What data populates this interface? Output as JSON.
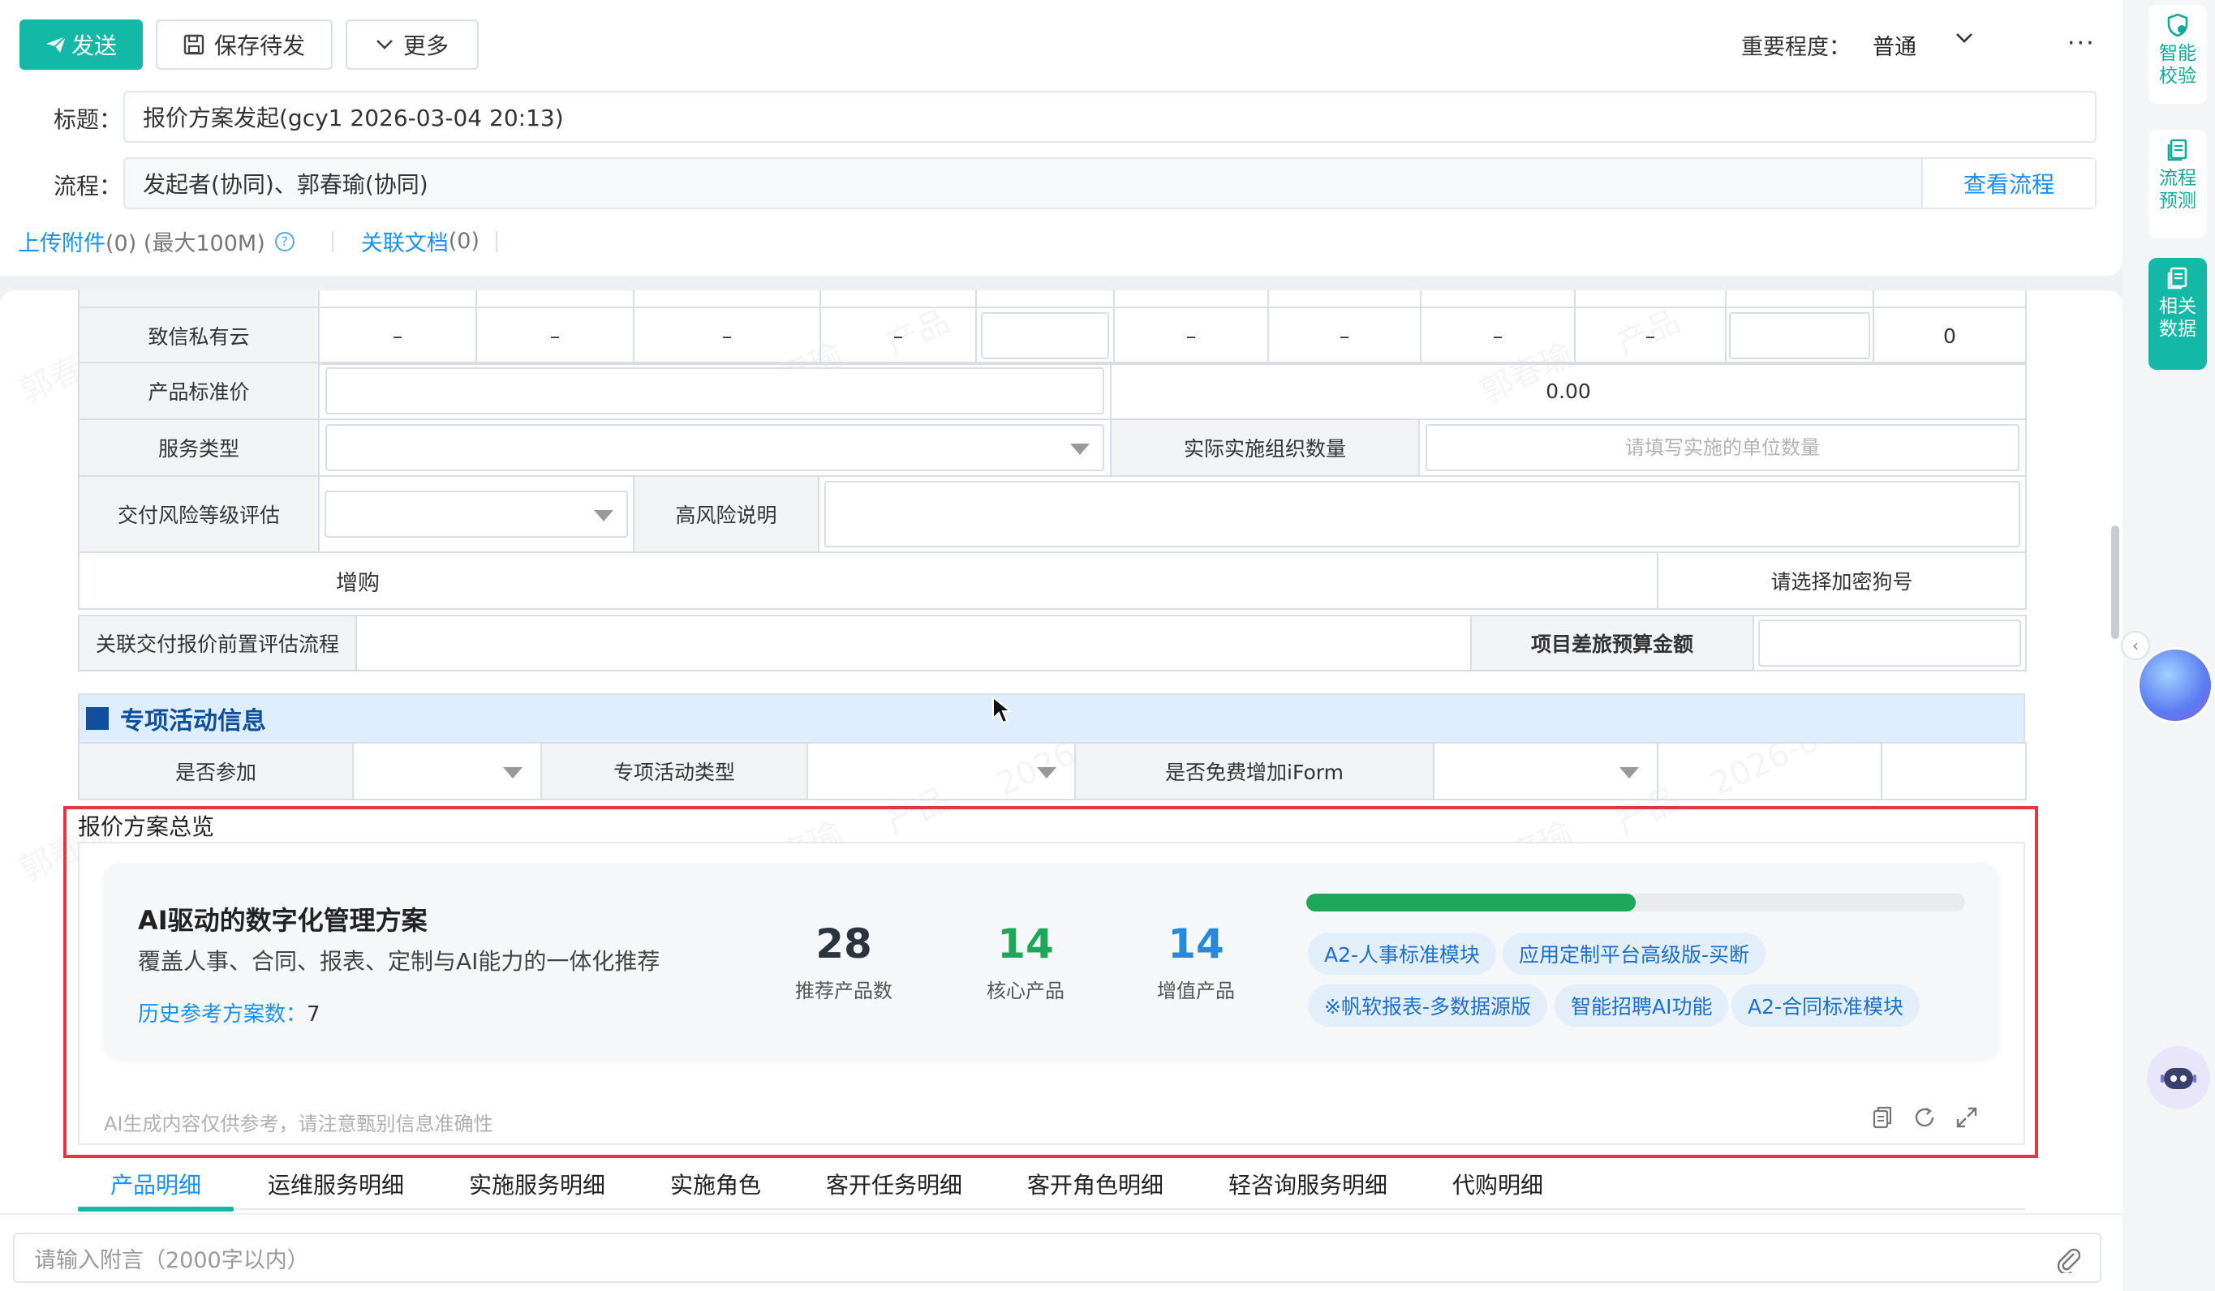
{
  "toolbar": {
    "send_label": "发送",
    "save_draft_label": "保存待发",
    "more_label": "更多",
    "importance_label": "重要程度：",
    "importance_value": "普通",
    "ellipsis": "···"
  },
  "form": {
    "title_label": "标题：",
    "title_value": "报价方案发起(gcy1 2026-03-04 20:13)",
    "flow_label": "流程：",
    "flow_value": "发起者(协同)、郭春瑜(协同)",
    "view_flow_label": "查看流程"
  },
  "attachments": {
    "upload_link": "上传附件",
    "upload_count": "(0) (最大100M)",
    "help_icon": "?",
    "related_docs_link": "关联文档",
    "related_docs_count": "(0)"
  },
  "table": {
    "row_private_cloud": {
      "label": "致信私有云",
      "dash": "–",
      "value_last": "0"
    },
    "product_price": {
      "label": "产品标准价",
      "value": "0.00"
    },
    "service_type": {
      "label": "服务类型",
      "actual_org_label": "实际实施组织数量",
      "actual_org_placeholder": "请填写实施的单位数量"
    },
    "risk": {
      "label": "交付风险等级评估",
      "high_risk_label": "高风险说明"
    },
    "addon": {
      "label": "增购",
      "dongle_placeholder": "请选择加密狗号"
    },
    "related_eval": {
      "label": "关联交付报价前置评估流程",
      "travel_budget_label": "项目差旅预算金额"
    }
  },
  "special": {
    "title": "专项活动信息",
    "participate_label": "是否参加",
    "activity_type_label": "专项活动类型",
    "free_iform_label": "是否免费增加iForm"
  },
  "overview": {
    "section_label": "报价方案总览",
    "plan_title": "AI驱动的数字化管理方案",
    "plan_desc": "覆盖人事、合同、报表、定制与AI能力的一体化推荐",
    "history_label": "历史参考方案数：",
    "history_value": "7",
    "stats": [
      {
        "value": "28",
        "caption": "推荐产品数",
        "color": "#2c3440"
      },
      {
        "value": "14",
        "caption": "核心产品",
        "color": "#1ea65a"
      },
      {
        "value": "14",
        "caption": "增值产品",
        "color": "#2a88d8"
      }
    ],
    "core_ratio": 0.5,
    "chips": [
      "A2-人事标准模块",
      "应用定制平台高级版-买断",
      "※帆软报表-多数据源版",
      "智能招聘AI功能",
      "A2-合同标准模块"
    ],
    "disclaimer": "AI生成内容仅供参考，请注意甄别信息准确性"
  },
  "tabs": [
    "产品明细",
    "运维服务明细",
    "实施服务明细",
    "实施角色",
    "客开任务明细",
    "客开角色明细",
    "轻咨询服务明细",
    "代购明细"
  ],
  "comment": {
    "placeholder": "请输入附言（2000字以内）"
  },
  "rail": {
    "smart_check": "智能校验",
    "flow_predict": "流程预测",
    "related_data": "相关数据"
  },
  "watermark": {
    "name": "郭春瑜",
    "product": "产品",
    "date": "2026-06-17"
  },
  "colors": {
    "accent": "#14b8a6",
    "link": "#1890ff",
    "highlight_frame": "#e5353d",
    "section_blue": "#0f4f9c"
  }
}
